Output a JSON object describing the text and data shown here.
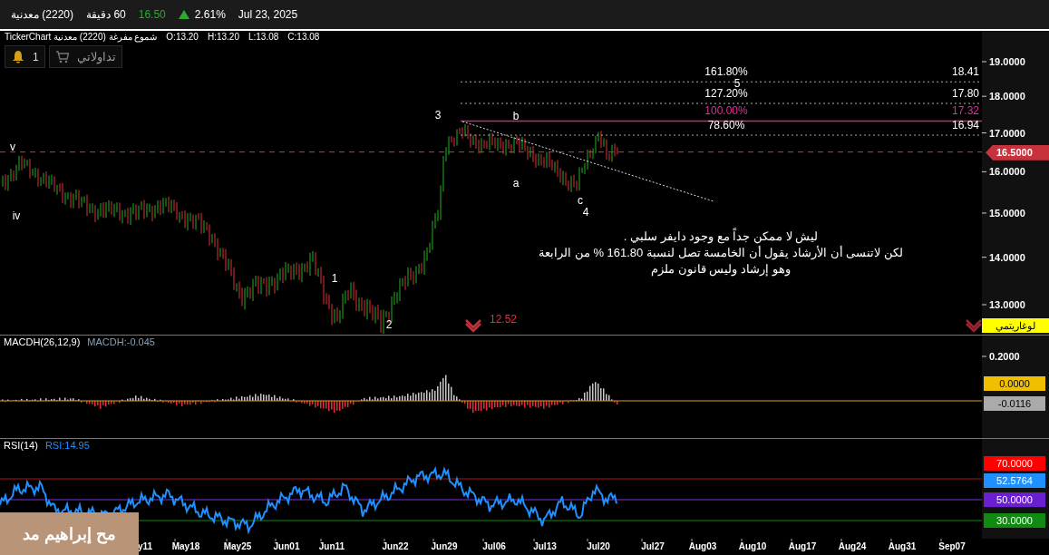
{
  "header": {
    "symbol": "(2220) معدنية",
    "interval": "60 دقيقة",
    "price": "16.50",
    "change": "2.61%",
    "date": "Jul 23, 2025"
  },
  "chart_info": {
    "title": "شموع مفرغة (2220) معدنية TickerChart",
    "open": "O:13.20",
    "high": "H:13.20",
    "low": "L:13.08",
    "close": "C:13.08"
  },
  "toolbar": {
    "alerts_count": "1",
    "trades_button": "تداولاتي"
  },
  "price_axis": {
    "ticks": [
      "19.0000",
      "18.0000",
      "17.0000",
      "16.0000",
      "15.0000",
      "14.0000",
      "13.0000"
    ],
    "current_price": "16.5000",
    "scale_mode": "لوغاريتمي"
  },
  "fib_levels": [
    {
      "percent": "161.80%",
      "value": "18.41",
      "highlighted": false
    },
    {
      "percent": "127.20%",
      "value": "17.80",
      "highlighted": false
    },
    {
      "percent": "100.00%",
      "value": "17.32",
      "highlighted": true
    },
    {
      "percent": "78.60%",
      "value": "16.94",
      "highlighted": false
    }
  ],
  "wave_labels": [
    "v",
    "iv",
    "1",
    "2",
    "3",
    "b",
    "a",
    "c",
    "4",
    "5"
  ],
  "low_marker": "12.52",
  "annotation": [
    "ليش لا ممكن جداً  مع وجود دايفر سلبي .",
    "لكن لاتنسى أن الأرشاد يقول أن الخامسة تصل لنسبة 161.80 % من الرابعة",
    "وهو إرشاد وليس قانون ملزم"
  ],
  "macd": {
    "title": "MACDH(26,12,9)",
    "reading": "MACDH:-0.045",
    "ticks": [
      "0.2000"
    ],
    "zero_tag": "0.0000",
    "value_tag": "-0.0116"
  },
  "rsi": {
    "title": "RSI(14)",
    "reading": "RSI:14.95",
    "tags": [
      {
        "text": "70.0000",
        "kind": "overbought"
      },
      {
        "text": "52.5764",
        "kind": "value"
      },
      {
        "text": "50.0000",
        "kind": "mid"
      },
      {
        "text": "30.0000",
        "kind": "oversold"
      }
    ]
  },
  "time_axis": [
    "y11",
    "May18",
    "May25",
    "Jun01",
    "Jun11",
    "Jun22",
    "Jun29",
    "Jul06",
    "Jul13",
    "Jul20",
    "Jul27",
    "Aug03",
    "Aug10",
    "Aug17",
    "Aug24",
    "Aug31",
    "Sep07"
  ],
  "author_stamp": "مح إبراهيم مد"
}
